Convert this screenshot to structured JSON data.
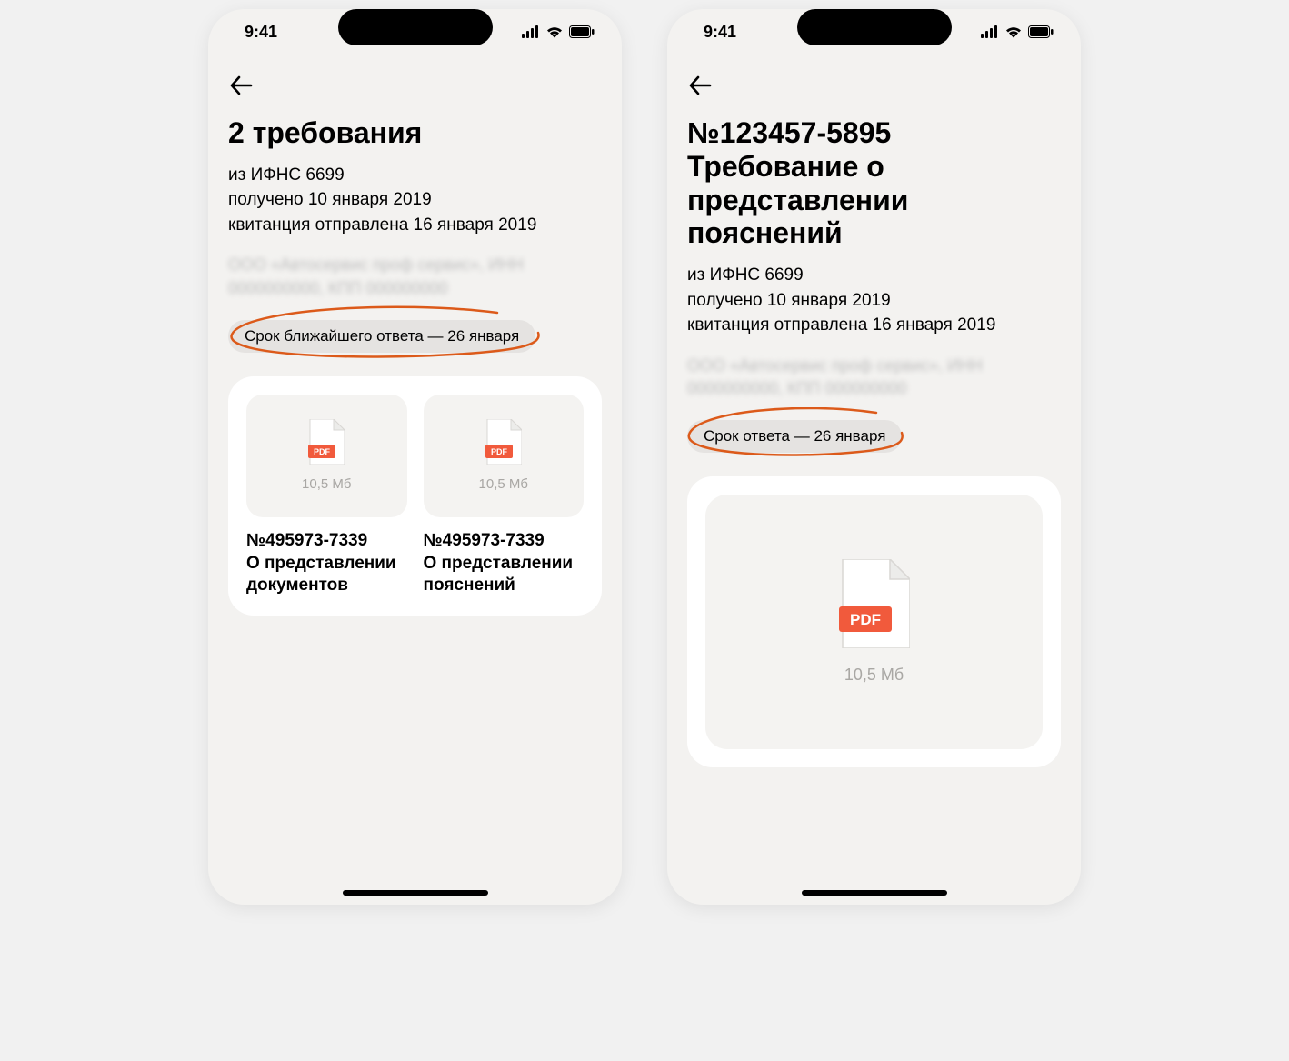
{
  "status": {
    "time": "9:41"
  },
  "left": {
    "title": "2 требования",
    "meta": {
      "source": "из ИФНС 6699",
      "received": "получено 10 января 2019",
      "receipt": "квитанция отправлена 16 января 2019"
    },
    "org_blurred": "ООО «Автосервис проф сервис»,\nИНН 0000000000, КПП 000000000",
    "deadline": "Срок ближайшего ответа — 26 января",
    "docs": [
      {
        "file_label": "PDF",
        "size": "10,5 Мб",
        "number": "№495973-7339",
        "desc": "О представлении документов"
      },
      {
        "file_label": "PDF",
        "size": "10,5 Мб",
        "number": "№495973-7339",
        "desc": "О представлении пояснений"
      }
    ]
  },
  "right": {
    "title": "№123457-5895 Требование о представлении пояснений",
    "meta": {
      "source": "из ИФНС 6699",
      "received": "получено 10 января 2019",
      "receipt": "квитанция отправлена 16 января 2019"
    },
    "org_blurred": "ООО «Автосервис проф сервис»,\nИНН 0000000000, КПП 000000000",
    "deadline": "Срок ответа — 26 января",
    "doc": {
      "file_label": "PDF",
      "size": "10,5 Мб"
    }
  }
}
